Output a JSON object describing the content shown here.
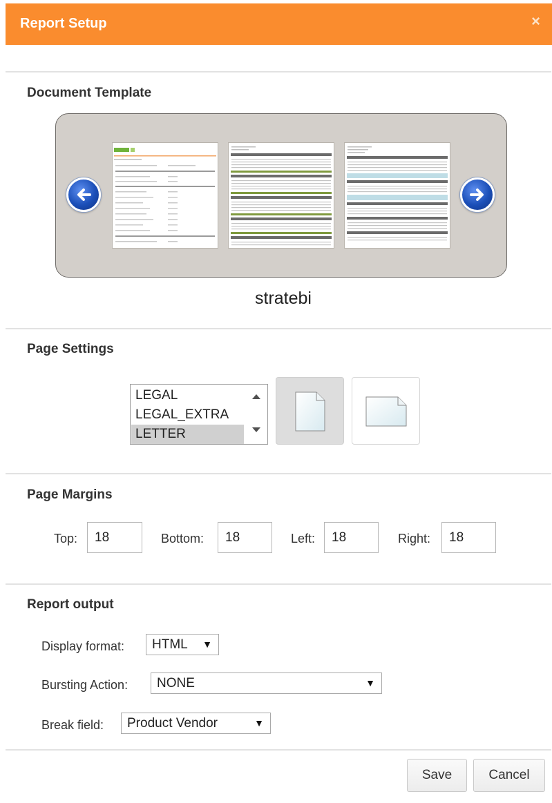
{
  "dialog": {
    "title": "Report Setup",
    "close_glyph": "×"
  },
  "accent_color": "#fa8c2e",
  "template_section": {
    "title": "Document Template",
    "selected_template_name": "stratebi",
    "thumbnails": [
      {
        "icon": "template-thumbnail-stratebi"
      },
      {
        "icon": "template-thumbnail-green-table"
      },
      {
        "icon": "template-thumbnail-blue-table"
      }
    ],
    "prev_icon": "arrow-left-icon",
    "next_icon": "arrow-right-icon"
  },
  "page_settings": {
    "title": "Page Settings",
    "paper_sizes": [
      "LEGAL",
      "LEGAL_EXTRA",
      "LETTER"
    ],
    "selected_paper_size": "LETTER",
    "orientation_icons": [
      "portrait-page-icon",
      "landscape-page-icon"
    ],
    "selected_orientation": "portrait"
  },
  "page_margins": {
    "title": "Page Margins",
    "top": {
      "label": "Top:",
      "value": "18"
    },
    "bottom": {
      "label": "Bottom:",
      "value": "18"
    },
    "left": {
      "label": "Left:",
      "value": "18"
    },
    "right": {
      "label": "Right:",
      "value": "18"
    }
  },
  "report_output": {
    "title": "Report output",
    "display_format": {
      "label": "Display format:",
      "value": "HTML"
    },
    "bursting_action": {
      "label": "Bursting Action:",
      "value": "NONE"
    },
    "break_field": {
      "label": "Break field:",
      "value": "Product Vendor"
    },
    "caret_glyph": "▼"
  },
  "footer": {
    "save_label": "Save",
    "cancel_label": "Cancel"
  }
}
